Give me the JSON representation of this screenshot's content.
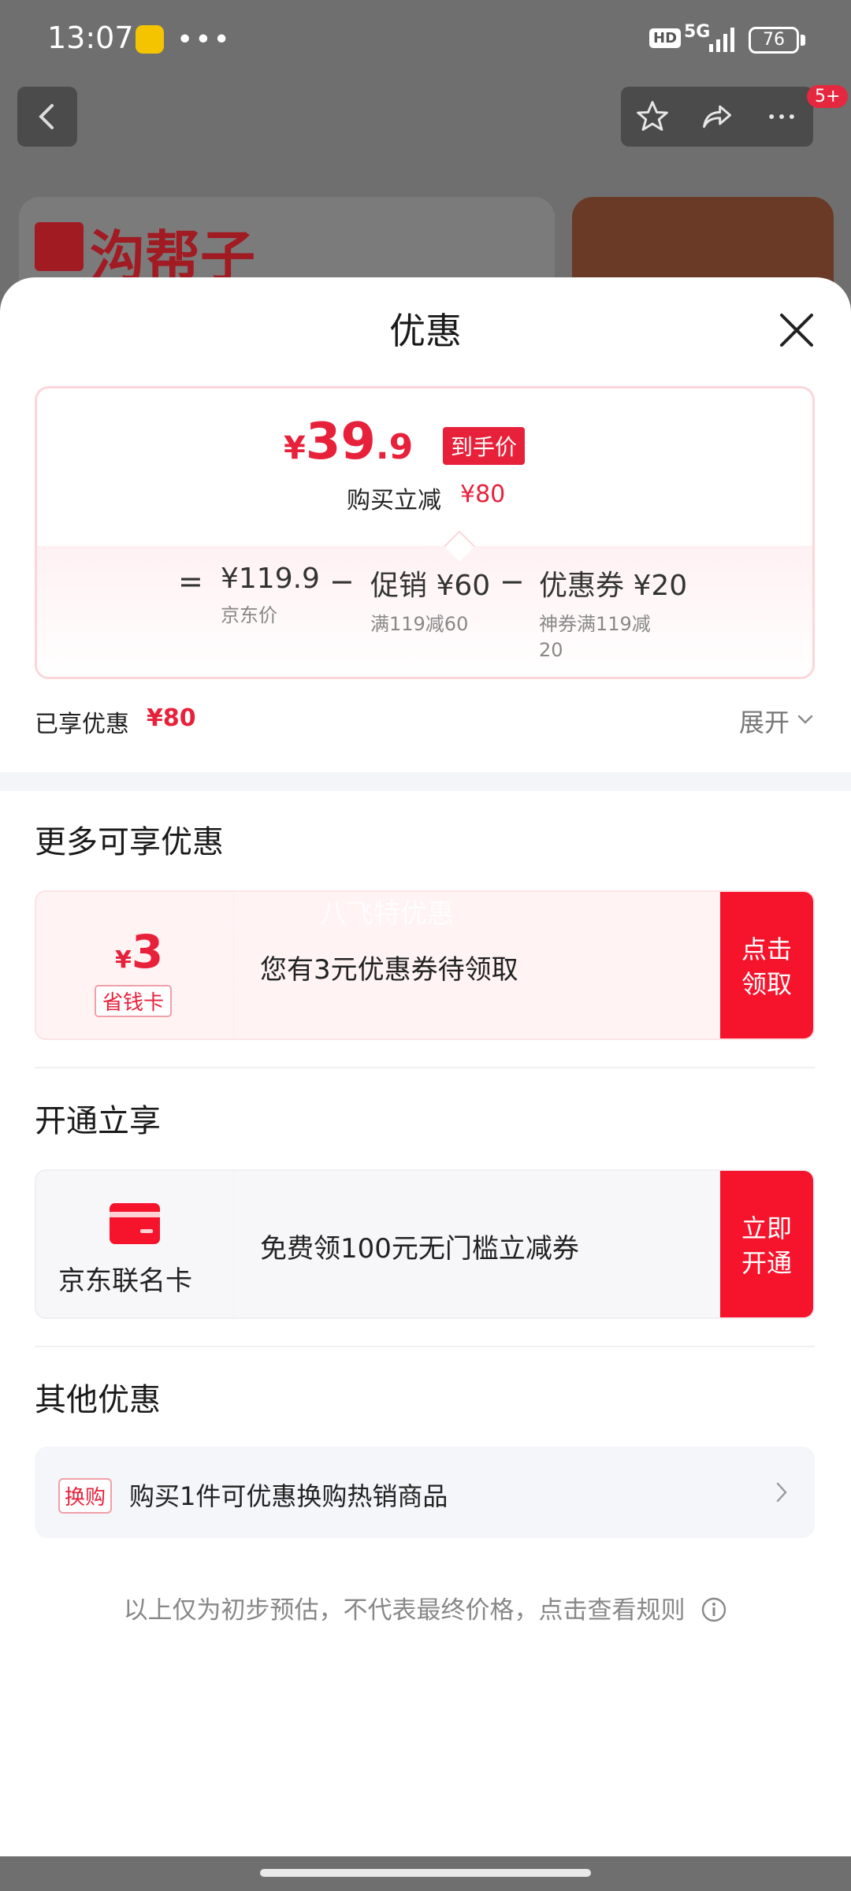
{
  "status_bar": {
    "time": "13:07",
    "more": "•••",
    "hd": "HD",
    "network": "5G",
    "battery": "76"
  },
  "header": {
    "notification_badge": "5+"
  },
  "background": {
    "logo_text": "沟帮子"
  },
  "sheet": {
    "title": "优惠",
    "price_summary": {
      "currency": "¥",
      "price_int": "39",
      "price_dec": ".9",
      "price_tag": "到手价",
      "reduce_label": "购买立减",
      "reduce_value": "¥80",
      "formula": {
        "equals": "=",
        "items": [
          {
            "value": "¥119.9",
            "label": "京东价"
          },
          {
            "value": "促销 ¥60",
            "label": "满119减60"
          },
          {
            "value": "优惠券 ¥20",
            "label": "神券满119减",
            "label2": "20"
          }
        ],
        "minus": "−"
      },
      "enjoyed_label": "已享优惠",
      "enjoyed_value": "¥80",
      "expand_label": "展开"
    },
    "more_offers": {
      "title": "更多可享优惠",
      "card": {
        "currency": "¥",
        "amount": "3",
        "tag": "省钱卡",
        "watermark": "八飞特优惠",
        "text": "您有3元优惠券待领取",
        "button_line1": "点击",
        "button_line2": "领取"
      }
    },
    "open_now": {
      "title": "开通立享",
      "card": {
        "card_name": "京东联名卡",
        "text": "免费领100元无门槛立减券",
        "button_line1": "立即",
        "button_line2": "开通"
      }
    },
    "other_offers": {
      "title": "其他优惠",
      "row": {
        "tag": "换购",
        "text": "购买1件可优惠换购热销商品"
      }
    },
    "footnote": "以上仅为初步预估，不代表最终价格，点击查看规则"
  },
  "colors": {
    "accent_red": "#e8213b",
    "button_red": "#f5142c"
  }
}
